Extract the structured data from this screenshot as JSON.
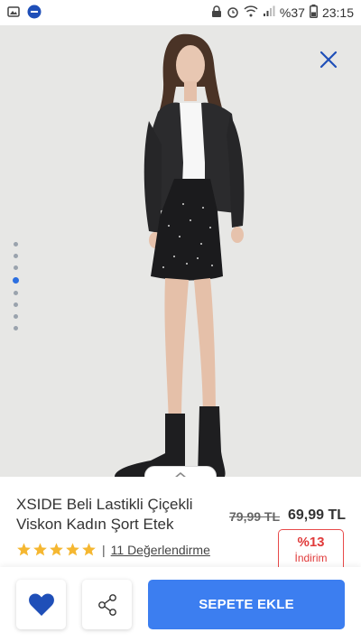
{
  "status_bar": {
    "battery_text": "%37",
    "time": "23:15"
  },
  "product": {
    "title": "XSIDE Beli Lastikli Çiçekli Viskon Kadın Şort Etek",
    "old_price": "79,99 TL",
    "new_price": "69,99 TL",
    "discount_percent": "%13",
    "discount_label": "İndirim",
    "rating_stars": 5,
    "review_separator": "|",
    "review_link": "11 Değerlendirme"
  },
  "gallery": {
    "dot_count": 8,
    "active_dot_index": 3
  },
  "actions": {
    "add_to_cart_label": "SEPETE EKLE"
  },
  "colors": {
    "accent_blue": "#3c7ef0",
    "favorite_blue": "#1f4fb8",
    "discount_red": "#e03a3a",
    "star_yellow": "#f5b731",
    "close_blue": "#1f4fb8"
  },
  "icons": {
    "close": "close-icon",
    "favorite": "heart-icon",
    "share": "share-icon",
    "collapse": "chevron-up-icon"
  }
}
